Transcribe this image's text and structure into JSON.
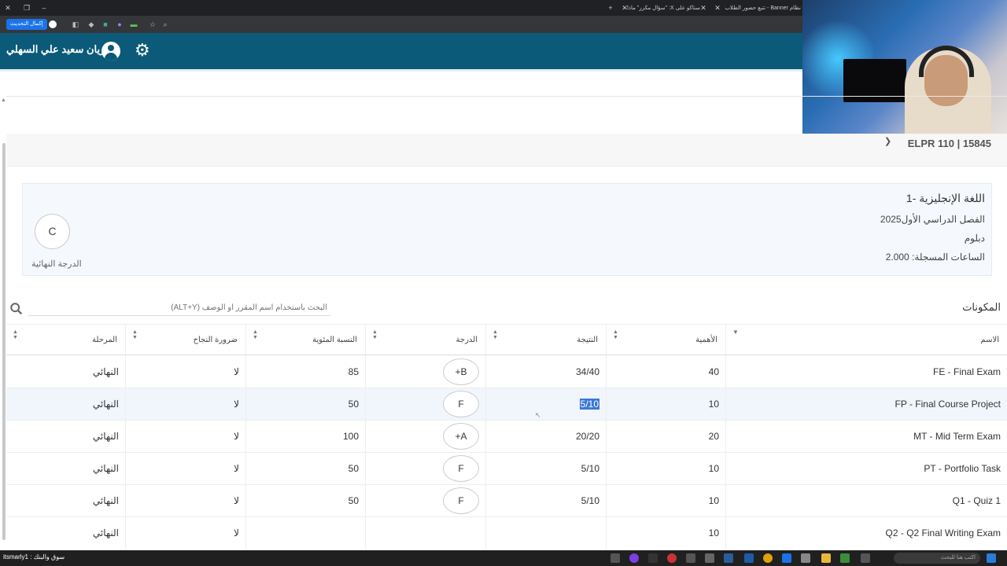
{
  "browser": {
    "tabs": [
      {
        "label": "نظام Banner - تتبع حضور الطلاب"
      },
      {
        "label": "ستاكو على X: \"سؤال مكرر\" ماذا"
      }
    ],
    "refresh_label": "إكمال التحديث"
  },
  "header": {
    "user_name": "ريان سعيد علي السهلي",
    "avatar_icon": "user-avatar-icon",
    "settings_icon": "gear-icon",
    "color": "#0b5a79"
  },
  "course": {
    "code": "ELPR 110 | 15845",
    "title": "اللغة الإنجليزية -1",
    "term": "الفصل الدراسي الأول2025",
    "level": "دبلوم",
    "hours_label": "الساعات المسجلة:",
    "hours_value": "2.000",
    "final_grade": "C",
    "final_grade_label": "الدرجة النهائية"
  },
  "components": {
    "title": "المكونات",
    "search_placeholder": "البحث باستخدام اسم المقرر أو الوصف (ALT+Y)",
    "columns": [
      "الاسم",
      "الأهمية",
      "النتيجة",
      "الدرجة",
      "النسبة المئوية",
      "ضرورة النجاح",
      "المرحلة"
    ],
    "rows": [
      {
        "name": "FE - Final Exam",
        "weight": "40",
        "score": "34/40",
        "grade": "+B",
        "percent": "85",
        "required": "لا",
        "phase": "النهائي"
      },
      {
        "name": "FP - Final Course Project",
        "weight": "10",
        "score": "5/10",
        "grade": "F",
        "percent": "50",
        "required": "لا",
        "phase": "النهائي"
      },
      {
        "name": "MT - Mid Term Exam",
        "weight": "20",
        "score": "20/20",
        "grade": "+A",
        "percent": "100",
        "required": "لا",
        "phase": "النهائي"
      },
      {
        "name": "PT - Portfolio Task",
        "weight": "10",
        "score": "5/10",
        "grade": "F",
        "percent": "50",
        "required": "لا",
        "phase": "النهائي"
      },
      {
        "name": "Q1 - Quiz 1",
        "weight": "10",
        "score": "5/10",
        "grade": "F",
        "percent": "50",
        "required": "لا",
        "phase": "النهائي"
      },
      {
        "name": "Q2 - Q2 Final Writing Exam",
        "weight": "10",
        "score": "",
        "grade": "",
        "percent": "",
        "required": "لا",
        "phase": "النهائي"
      }
    ]
  },
  "taskbar": {
    "left_text": "سوق والبنك : itsmarly1",
    "search_placeholder": "اكتب هنا للبحث"
  }
}
